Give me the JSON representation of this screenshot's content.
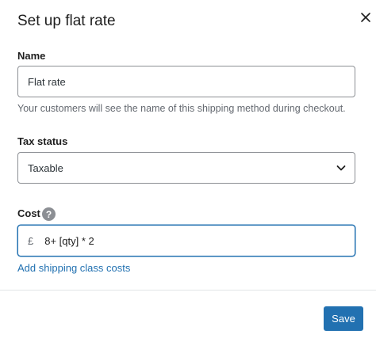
{
  "modal": {
    "title": "Set up flat rate",
    "close_icon": "close-icon"
  },
  "name_field": {
    "label": "Name",
    "value": "Flat rate",
    "help": "Your customers will see the name of this shipping method during checkout."
  },
  "tax_status": {
    "label": "Tax status",
    "selected": "Taxable",
    "icon": "chevron-down-icon"
  },
  "cost": {
    "label": "Cost",
    "help_icon": "help-icon",
    "help_glyph": "?",
    "currency": "£",
    "value": "8+ [qty] * 2"
  },
  "links": {
    "add_shipping_class_costs": "Add shipping class costs"
  },
  "footer": {
    "save_label": "Save"
  },
  "colors": {
    "accent": "#2271b1",
    "muted_text": "#646970",
    "border": "#8c8f94"
  }
}
